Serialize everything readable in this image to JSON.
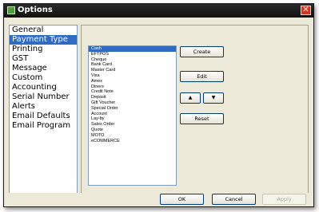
{
  "window": {
    "title": "Options",
    "close_glyph": "✕"
  },
  "sidebar": {
    "items": [
      {
        "label": "General"
      },
      {
        "label": "Payment Type"
      },
      {
        "label": "Printing"
      },
      {
        "label": "GST"
      },
      {
        "label": "Message"
      },
      {
        "label": "Custom"
      },
      {
        "label": "Accounting"
      },
      {
        "label": "Serial Number"
      },
      {
        "label": "Alerts"
      },
      {
        "label": "Email Defaults"
      },
      {
        "label": "Email Program"
      }
    ],
    "selected": "Payment Type"
  },
  "payment_types": {
    "items": [
      "Cash",
      "EFTPOS",
      "Cheque",
      "Bank Card",
      "Master Card",
      "Visa",
      "Amex",
      "Diners",
      "Credit Note",
      "Deposit",
      "Gift Voucher",
      "Special Order",
      "Account",
      "Lay-by",
      "Sales Order",
      "Quote",
      "MOTO",
      "eCOMMERCE"
    ],
    "selected": "Cash"
  },
  "buttons": {
    "create": "Create",
    "edit": "Edit",
    "move_up": "▲",
    "move_down": "▼",
    "reset": "Reset",
    "ok": "OK",
    "cancel": "Cancel",
    "apply": "Apply"
  },
  "colors": {
    "selection": "#316ac5",
    "close": "#d9311a",
    "titlebar": "#1a1a1a"
  }
}
